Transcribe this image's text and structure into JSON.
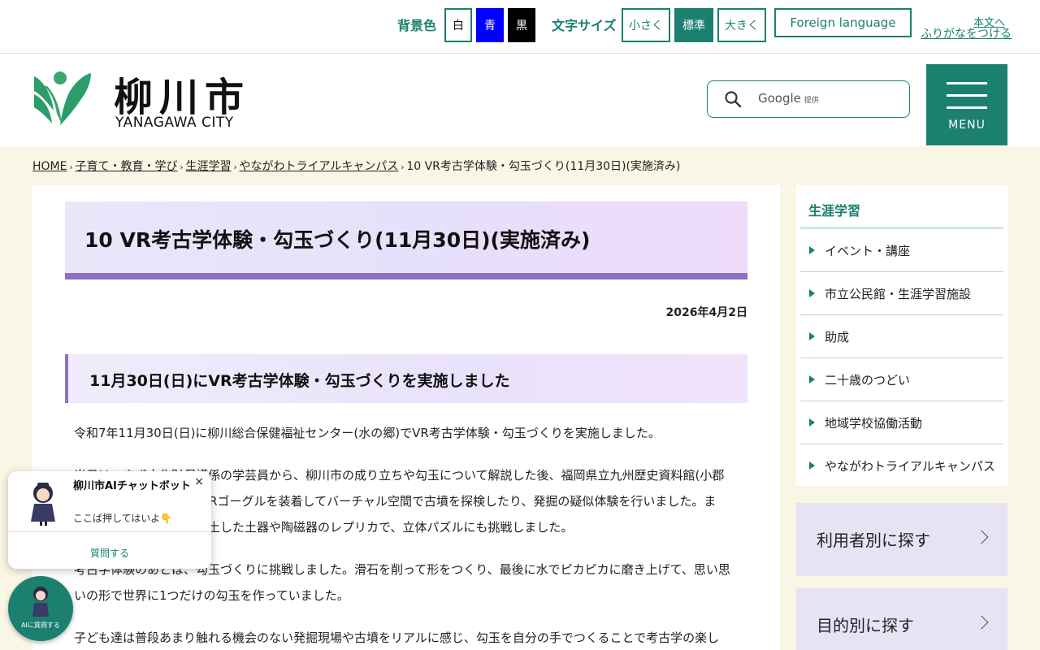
{
  "topbar": {
    "bg_color_label": "背景色",
    "bg_white": "白",
    "bg_blue": "青",
    "bg_black": "黒",
    "font_size_label": "文字サイズ",
    "font_small": "小さく",
    "font_standard": "標準",
    "font_large": "大きく",
    "foreign_language": "Foreign language",
    "read_aloud": "本文へ",
    "furigana": "ふりがなをつける"
  },
  "header": {
    "logo_ja": "柳川市",
    "logo_en": "YANAGAWA CITY",
    "search_provider": "Google",
    "search_provider_suffix": "提供",
    "menu_label": "MENU"
  },
  "breadcrumb": {
    "items": [
      "HOME",
      "子育て・教育・学び",
      "生涯学習",
      "やながわトライアルキャンパス"
    ],
    "current": "10  VR考古学体験・勾玉づくり(11月30日)(実施済み)"
  },
  "main": {
    "title": "10  VR考古学体験・勾玉づくり(11月30日)(実施済み)",
    "date": "2026年4月2日",
    "heading": "11月30日(日)にVR考古学体験・勾玉づくりを実施しました",
    "paragraphs": [
      "令和7年11月30日(日)に柳川総合保健福祉センター(水の郷)でVR考古学体験・勾玉づくりを実施しました。",
      "当日は、まず文化財保護係の学芸員から、柳川市の成り立ちや勾玉について解説した後、福岡県立九州歴史資料館(小郡市)の職員の方の指導でVRゴーグルを装着してバーチャル空間で古墳を探検したり、発掘の疑似体験を行いました。また、実際に柳川市内で出土した土器や陶磁器のレプリカで、立体パズルにも挑戦しました。",
      "考古学体験のあとは、勾玉づくりに挑戦しました。滑石を削って形をつくり、最後に水でピカピカに磨き上げて、思い思いの形で世界に1つだけの勾玉を作っていました。",
      "子ども達は普段あまり触れる機会のない発掘現場や古墳をリアルに感じ、勾玉を自分の手でつくることで考古学の楽し"
    ]
  },
  "sidebar": {
    "heading": "生涯学習",
    "items": [
      {
        "label": "イベント・講座"
      },
      {
        "label": "市立公民館・生涯学習施設"
      },
      {
        "label": "助成"
      },
      {
        "label": "二十歳のつどい"
      },
      {
        "label": "地域学校協働活動"
      },
      {
        "label": "やながわトライアルキャンパス"
      }
    ],
    "find_by_user": "利用者別に探す",
    "find_by_purpose": "目的別に探す"
  },
  "chatbot": {
    "title": "柳川市AIチャットボット",
    "subtitle": "ここば押してはいよ👇",
    "close": "×",
    "ask": "質問する",
    "fab_label": "AIに質問する"
  },
  "colors": {
    "brand_green": "#1b8070",
    "title_purple": "#8a72c4",
    "bg_blue_button": "#0000ff",
    "bg_black_button": "#000000"
  }
}
